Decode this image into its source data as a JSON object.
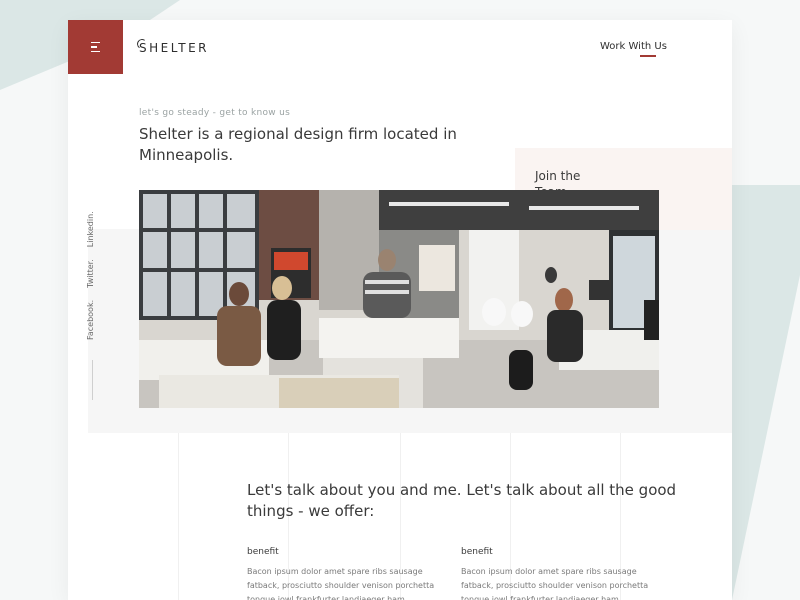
{
  "brand": {
    "logo": "SHELTER"
  },
  "header": {
    "work_link": "Work With Us"
  },
  "hero": {
    "eyebrow": "let's go steady - get to know us",
    "headline": "Shelter is a regional design firm located in Minneapolis."
  },
  "join": {
    "label": "Join the Team"
  },
  "social": [
    "Facebook.",
    "Twitter.",
    "Linkedin."
  ],
  "offer": {
    "title": "Let's talk about you and me. Let's talk about all the good things - we offer:",
    "benefits": [
      {
        "label": "benefit",
        "text": "Bacon ipsum dolor amet spare ribs sausage fatback, prosciutto shoulder venison porchetta tongue jowl frankfurter landjaeger ham."
      },
      {
        "label": "benefit",
        "text": "Bacon ipsum dolor amet spare ribs sausage fatback, prosciutto shoulder venison porchetta tongue jowl frankfurter landjaeger ham."
      }
    ]
  },
  "colors": {
    "accent": "#a23a34",
    "background": "#f6f8f8",
    "shape": "#dbe7e6",
    "join_bg": "#faf4f2"
  },
  "icons": {
    "menu": "hamburger-icon",
    "arrow": "arrow-right-icon"
  }
}
